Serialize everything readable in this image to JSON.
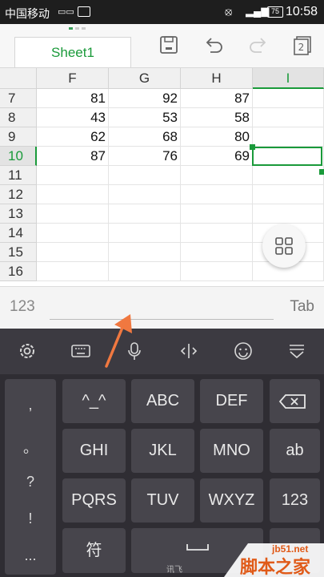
{
  "status_bar": {
    "carrier": "中国移动",
    "battery": "75",
    "time": "10:58"
  },
  "toolbar": {
    "sheet_tab": "Sheet1"
  },
  "grid": {
    "columns": [
      "F",
      "G",
      "H",
      "I"
    ],
    "rows": [
      {
        "num": "7",
        "cells": [
          "81",
          "92",
          "87",
          ""
        ]
      },
      {
        "num": "8",
        "cells": [
          "43",
          "53",
          "58",
          ""
        ]
      },
      {
        "num": "9",
        "cells": [
          "62",
          "68",
          "80",
          ""
        ]
      },
      {
        "num": "10",
        "cells": [
          "87",
          "76",
          "69",
          ""
        ]
      },
      {
        "num": "11",
        "cells": [
          "",
          "",
          "",
          ""
        ]
      },
      {
        "num": "12",
        "cells": [
          "",
          "",
          "",
          ""
        ]
      },
      {
        "num": "13",
        "cells": [
          "",
          "",
          "",
          ""
        ]
      },
      {
        "num": "14",
        "cells": [
          "",
          "",
          "",
          ""
        ]
      },
      {
        "num": "15",
        "cells": [
          "",
          "",
          "",
          ""
        ]
      },
      {
        "num": "16",
        "cells": [
          "",
          "",
          "",
          ""
        ]
      }
    ],
    "selected_column": "I",
    "selected_row": "10"
  },
  "input_bar": {
    "mode_label": "123",
    "tab_label": "Tab"
  },
  "keyboard": {
    "side_keys": [
      ",",
      "。",
      "?",
      "!",
      "..."
    ],
    "rows": [
      [
        "^_^",
        "ABC",
        "DEF",
        "⌫"
      ],
      [
        "GHI",
        "JKL",
        "MNO",
        "ab"
      ],
      [
        "PQRS",
        "TUV",
        "WXYZ",
        "123"
      ],
      [
        "符",
        "space",
        "",
        ""
      ]
    ],
    "brand": "讯飞"
  },
  "watermark": {
    "site": "jb51.net",
    "name": "脚本之家"
  },
  "colors": {
    "accent_green": "#1a9a3a",
    "arrow": "#f07840",
    "keyboard_bg": "#2f2d33"
  }
}
